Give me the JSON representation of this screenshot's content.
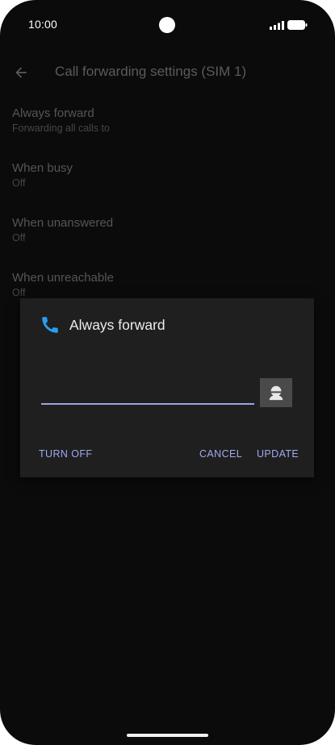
{
  "status_bar": {
    "time": "10:00"
  },
  "app_bar": {
    "back_icon": "arrow-back-icon",
    "title": "Call forwarding settings (SIM 1)"
  },
  "settings": [
    {
      "title": "Always forward",
      "summary": "Forwarding all calls to"
    },
    {
      "title": "When busy",
      "summary": "Off"
    },
    {
      "title": "When unanswered",
      "summary": "Off"
    },
    {
      "title": "When unreachable",
      "summary": "Off"
    }
  ],
  "dialog": {
    "icon": "phone-icon",
    "title": "Always forward",
    "number_value": "",
    "contact_icon": "contact-icon",
    "buttons": {
      "turn_off": "TURN OFF",
      "cancel": "CANCEL",
      "update": "UPDATE"
    }
  },
  "colors": {
    "background": "#0b0b0b",
    "dialog_bg": "#1f1f1f",
    "accent": "#9fa9f0",
    "phone_icon": "#2a9df4"
  }
}
